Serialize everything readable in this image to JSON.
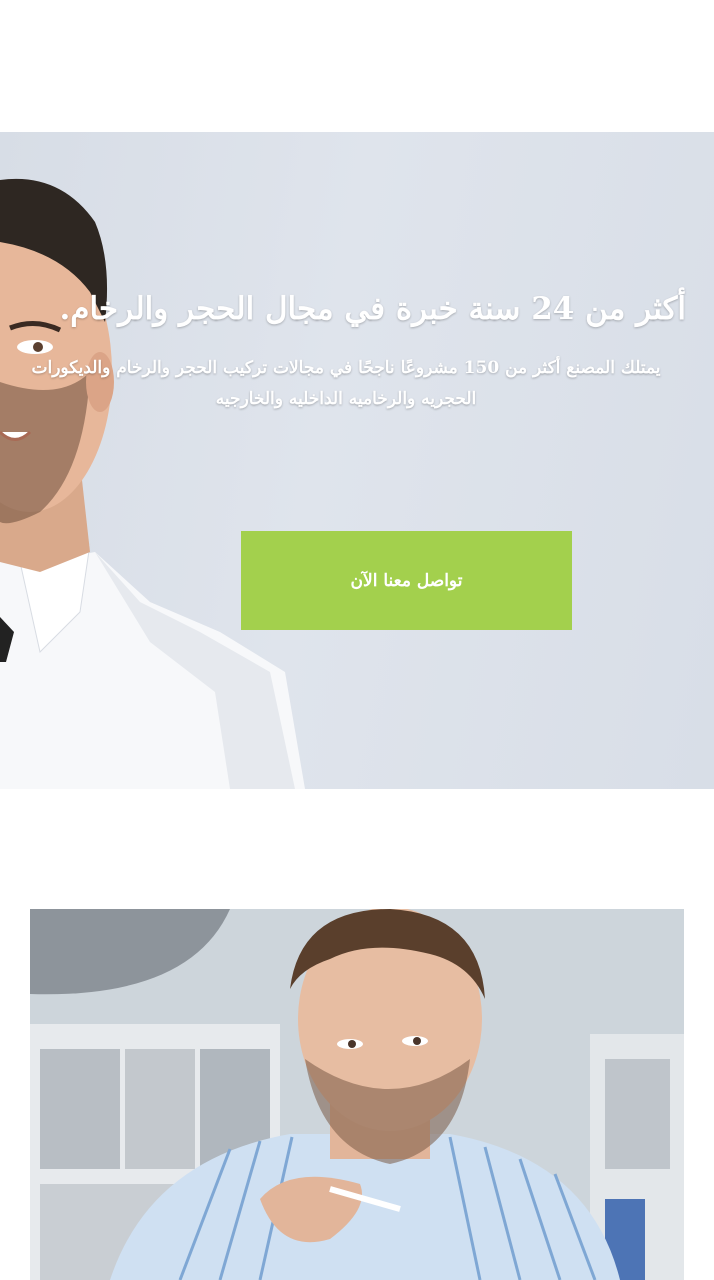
{
  "hero": {
    "title": "أكثر من 24 سنة خبرة في مجال الحجر والرخام.",
    "subtitle": "يمتلك المصنع أكثر من 150 مشروعًا ناجحًا في مجالات تركيب الحجر والرخام والديكورات الحجريه والرخاميه الداخليه والخارجيه",
    "cta_label": "تواصل معنا الآن"
  },
  "colors": {
    "cta_background": "#a3d04d",
    "hero_background": "#dce1e9",
    "text": "#ffffff"
  }
}
